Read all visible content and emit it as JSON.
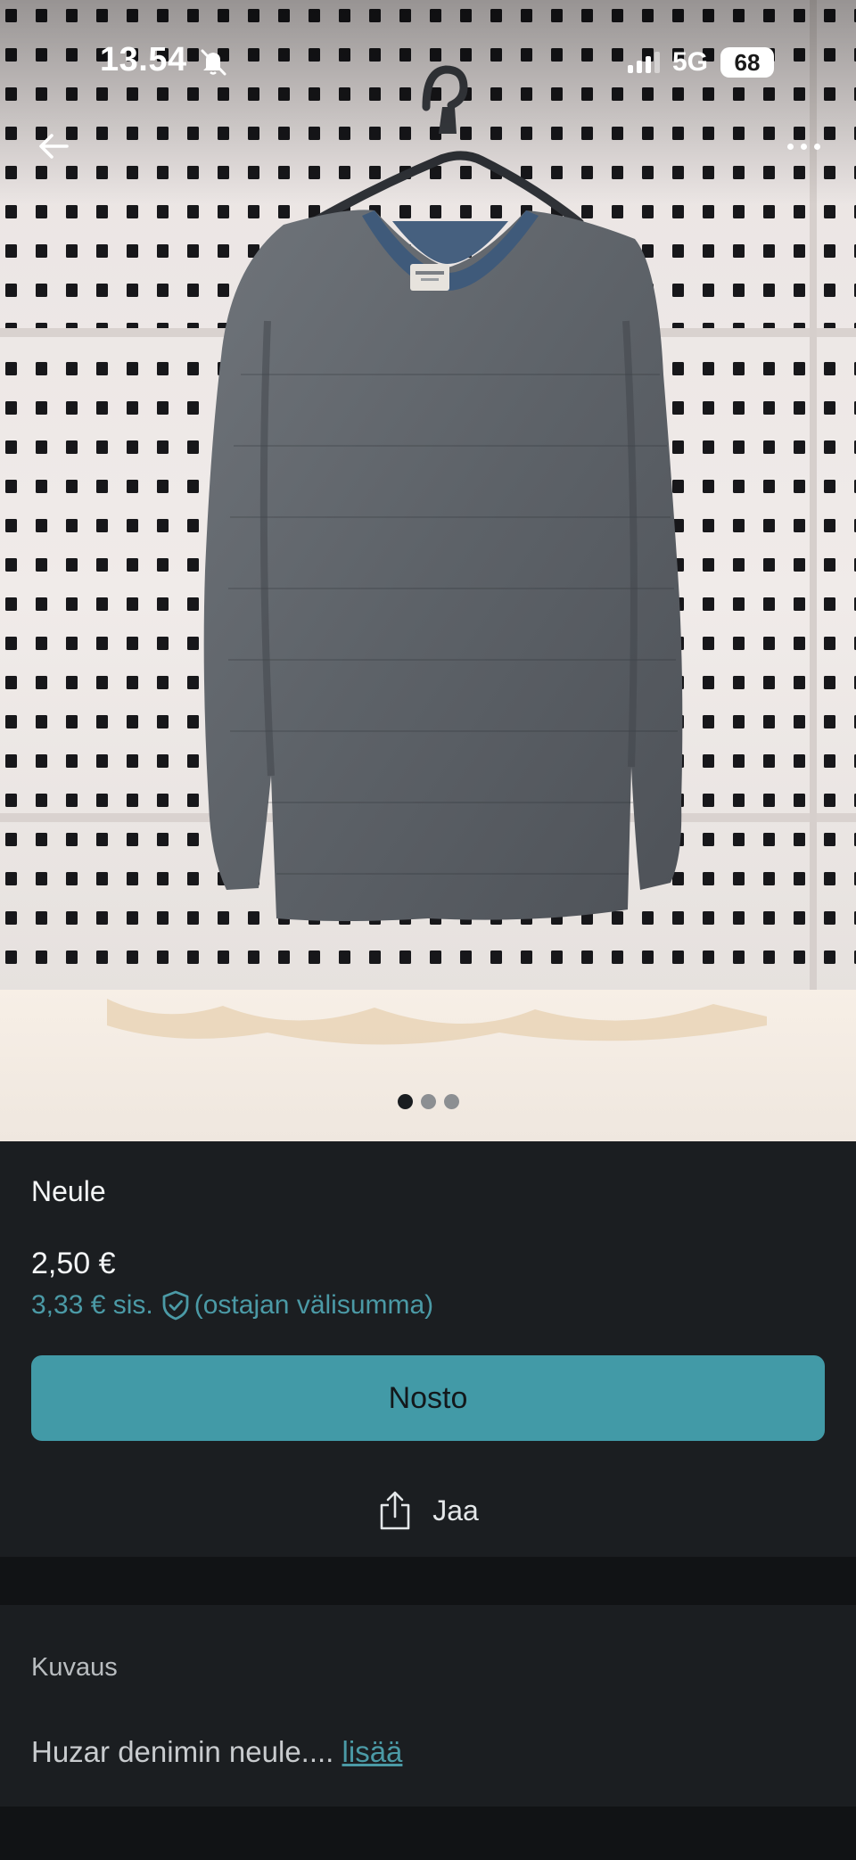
{
  "status_bar": {
    "time": "13.54",
    "network": "5G",
    "battery": "68",
    "mute_icon": "bell-slash-icon"
  },
  "photo": {
    "subject": "grey knit sweater with blue collar on hanger",
    "slides_total": 3,
    "active_slide": 1
  },
  "nav": {
    "back_icon": "arrow-left-icon",
    "more_icon": "more-horizontal-icon"
  },
  "listing": {
    "title": "Neule",
    "price": "2,50 €",
    "buyer_price_prefix": "3,33 € sis.",
    "buyer_price_suffix": "(ostajan välisumma)",
    "buy_button_label": "Nosto",
    "share_label": "Jaa"
  },
  "description": {
    "heading": "Kuvaus",
    "text": "Huzar denimin neule....",
    "more_link": "lisää"
  },
  "colors": {
    "accent": "#429aa7",
    "accent_text": "#4b9aa6",
    "panel_bg": "#1b1e21",
    "page_bg": "#111315"
  }
}
